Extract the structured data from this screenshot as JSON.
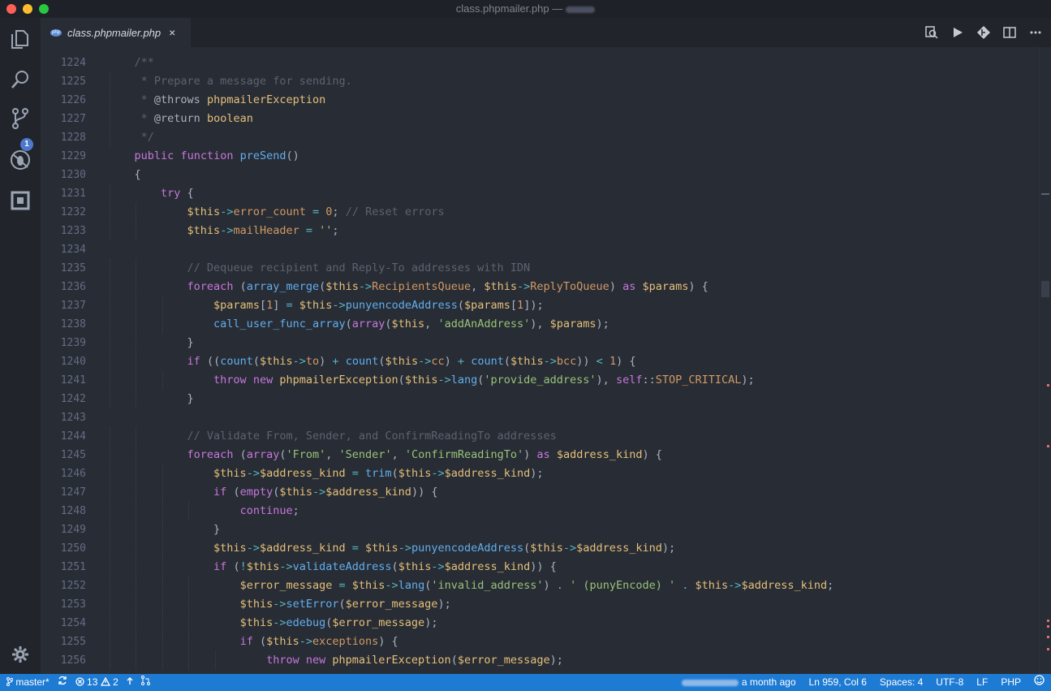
{
  "window": {
    "title": "class.phpmailer.php — config",
    "title_filename": "class.phpmailer.php",
    "title_separator": "—"
  },
  "tab": {
    "label": "class.phpmailer.php",
    "close_glyph": "×",
    "file_badge": "php"
  },
  "activity": {
    "scm_badge": "1",
    "icons": [
      "files-icon",
      "search-icon",
      "source-control-icon",
      "debug-icon",
      "extensions-icon",
      "settings-gear-icon"
    ]
  },
  "toolbar": {
    "icons": [
      "open-changes-icon",
      "run-icon",
      "git-compare-icon",
      "split-editor-icon",
      "more-actions-icon"
    ]
  },
  "editor": {
    "line_numbers": [
      "1224",
      "1225",
      "1226",
      "1227",
      "1228",
      "1229",
      "1230",
      "1231",
      "1232",
      "1233",
      "1234",
      "1235",
      "1236",
      "1237",
      "1238",
      "1239",
      "1240",
      "1241",
      "1242",
      "1243",
      "1244",
      "1245",
      "1246",
      "1247",
      "1248",
      "1249",
      "1250",
      "1251",
      "1252",
      "1253",
      "1254",
      "1255",
      "1256"
    ],
    "lines": [
      "    /**",
      "     * Prepare a message for sending.",
      "     * @throws phpmailerException",
      "     * @return boolean",
      "     */",
      "    public function preSend()",
      "    {",
      "        try {",
      "            $this->error_count = 0; // Reset errors",
      "            $this->mailHeader = '';",
      "",
      "            // Dequeue recipient and Reply-To addresses with IDN",
      "            foreach (array_merge($this->RecipientsQueue, $this->ReplyToQueue) as $params) {",
      "                $params[1] = $this->punyencodeAddress($params[1]);",
      "                call_user_func_array(array($this, 'addAnAddress'), $params);",
      "            }",
      "            if ((count($this->to) + count($this->cc) + count($this->bcc)) < 1) {",
      "                throw new phpmailerException($this->lang('provide_address'), self::STOP_CRITICAL);",
      "            }",
      "",
      "            // Validate From, Sender, and ConfirmReadingTo addresses",
      "            foreach (array('From', 'Sender', 'ConfirmReadingTo') as $address_kind) {",
      "                $this->$address_kind = trim($this->$address_kind);",
      "                if (empty($this->$address_kind)) {",
      "                    continue;",
      "                }",
      "                $this->$address_kind = $this->punyencodeAddress($this->$address_kind);",
      "                if (!$this->validateAddress($this->$address_kind)) {",
      "                    $error_message = $this->lang('invalid_address') . ' (punyEncode) ' . $this->$address_kind;",
      "                    $this->setError($error_message);",
      "                    $this->edebug($error_message);",
      "                    if ($this->exceptions) {",
      "                        throw new phpmailerException($error_message);"
    ]
  },
  "status": {
    "branch": "master*",
    "errors": "13",
    "warnings": "2",
    "blame": "a month ago",
    "cursor": "Ln 959, Col 6",
    "spaces": "Spaces: 4",
    "encoding": "UTF-8",
    "eol": "LF",
    "language": "PHP"
  },
  "colors": {
    "status_bar": "#1e7bd4",
    "editor_bg": "#282c34",
    "keyword": "#c678dd",
    "function": "#61afef",
    "variable": "#e5c07b",
    "property": "#e06c75",
    "string": "#98c379",
    "comment": "#5c6370"
  }
}
